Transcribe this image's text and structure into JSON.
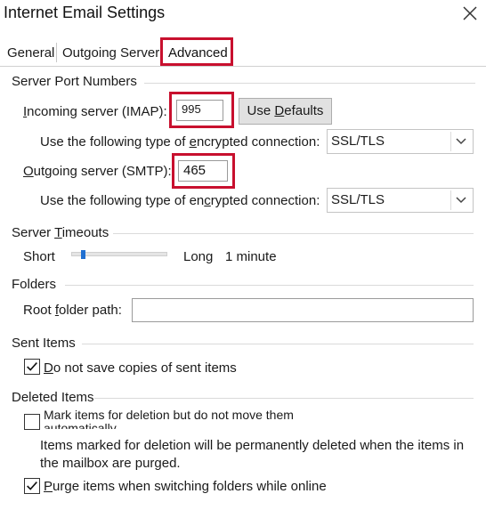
{
  "window": {
    "title": "Internet Email Settings",
    "close_icon": "close-icon"
  },
  "tabs": [
    {
      "label": "General"
    },
    {
      "label": "Outgoing Server"
    },
    {
      "label": "Advanced"
    }
  ],
  "active_tab": "Advanced",
  "server_ports": {
    "group_label": "Server Port Numbers",
    "incoming_label_pre": "",
    "incoming_label_ul": "I",
    "incoming_label_post": "ncoming server (IMAP):",
    "incoming_value": "995",
    "use_defaults_pre": "Use ",
    "use_defaults_ul": "D",
    "use_defaults_post": "efaults",
    "incoming_enc_pre": "Use the following type of ",
    "incoming_enc_ul": "e",
    "incoming_enc_post": "ncrypted connection:",
    "incoming_enc_value": "SSL/TLS",
    "outgoing_label_pre": "",
    "outgoing_label_ul": "O",
    "outgoing_label_post": "utgoing server (SMTP):",
    "outgoing_value": "465",
    "outgoing_enc_pre": "Use the following type of en",
    "outgoing_enc_ul": "c",
    "outgoing_enc_post": "rypted connection:",
    "outgoing_enc_value": "SSL/TLS"
  },
  "timeouts": {
    "group_label_pre": "Server ",
    "group_label_ul": "T",
    "group_label_post": "imeouts",
    "short_label": "Short",
    "long_label": "Long",
    "value_text": "1 minute",
    "slider_level": 0.1
  },
  "folders": {
    "group_label": "Folders",
    "root_label_pre": "Root ",
    "root_label_ul": "f",
    "root_label_post": "older path:",
    "root_value": ""
  },
  "sent_items": {
    "group_label": "Sent Items",
    "no_copies_ul": "D",
    "no_copies_post": "o not save copies of sent items",
    "no_copies_checked": true
  },
  "deleted_items": {
    "group_label": "Deleted Items",
    "mark_line1": "Mark items for deletion but do not move them",
    "mark_line2": "automatically",
    "mark_checked": false,
    "info_line1": "Items marked for deletion will be permanently deleted when the items in",
    "info_line2": "the mailbox are purged.",
    "purge_ul": "P",
    "purge_post": "urge items when switching folders while online",
    "purge_checked": true
  },
  "colors": {
    "highlight": "#c8102e",
    "dialog_bg": "#ffffff",
    "button_bg": "#e1e1e1"
  }
}
